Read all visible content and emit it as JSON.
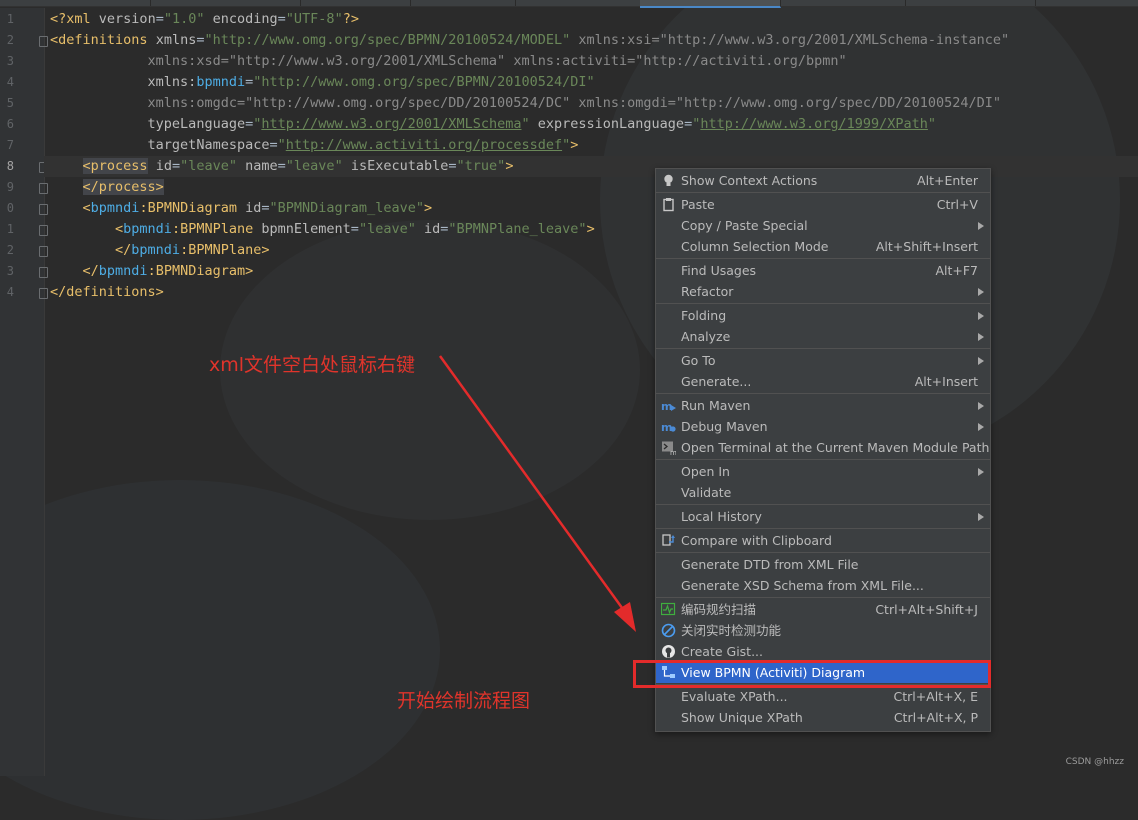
{
  "code": {
    "line1": {
      "num": "1"
    },
    "line2": {
      "num": "2"
    },
    "line3": {
      "num": "3"
    },
    "line4": {
      "num": "4"
    },
    "line5": {
      "num": "5"
    },
    "line6": {
      "num": "6"
    },
    "line7": {
      "num": "7"
    },
    "line8": {
      "num": "8"
    },
    "line9": {
      "num": "9"
    },
    "line10": {
      "num": "0"
    },
    "line11": {
      "num": "1"
    },
    "line12": {
      "num": "2"
    },
    "line13": {
      "num": "3"
    },
    "line14": {
      "num": "4"
    },
    "xml_decl": {
      "open": "<?",
      "tag": "xml",
      "attr1": "version",
      "val1": "\"1.0\"",
      "attr2": "encoding",
      "val2": "\"UTF-8\"",
      "close": "?>"
    },
    "definitions": {
      "open": "<",
      "tag": "definitions",
      "xmlns": "xmlns",
      "xmlns_val": "\"http://www.omg.org/spec/BPMN/20100524/MODEL\"",
      "xsi": "xmlns:xsi",
      "xsi_val": "\"http://www.w3.org/2001/XMLSchema-instance\"",
      "xsd": "xmlns:xsd",
      "xsd_val": "\"http://www.w3.org/2001/XMLSchema\"",
      "activiti": "xmlns:activiti",
      "activiti_val": "\"http://activiti.org/bpmn\"",
      "bpmndi_ns": "xmlns:",
      "bpmndi_name": "bpmndi",
      "bpmndi_val": "\"http://www.omg.org/spec/BPMN/20100524/DI\"",
      "omgdc": "xmlns:omgdc",
      "omgdc_val": "\"http://www.omg.org/spec/DD/20100524/DC\"",
      "omgdi": "xmlns:omgdi",
      "omgdi_val": "\"http://www.omg.org/spec/DD/20100524/DI\"",
      "typelang": "typeLanguage",
      "typelang_val_q1": "\"",
      "typelang_val_url": "http://www.w3.org/2001/XMLSchema",
      "typelang_val_q2": "\"",
      "exprlang": "expressionLanguage",
      "exprlang_val_q1": "\"",
      "exprlang_val_url": "http://www.w3.org/1999/XPath",
      "exprlang_val_q2": "\"",
      "targetns": "targetNamespace",
      "targetns_val_q1": "\"",
      "targetns_val_url": "http://www.activiti.org/processdef",
      "targetns_val_q2": "\"",
      "end": ">",
      "close": "</definitions>"
    },
    "process": {
      "open": "<process",
      "id": "id",
      "id_val": "\"leave\"",
      "name": "name",
      "name_val": "\"leave\"",
      "exec": "isExecutable",
      "exec_val": "\"true\"",
      "end": ">",
      "close": "</process>"
    },
    "diagram": {
      "open": "<",
      "prefix": "bpmndi",
      "colon": ":",
      "tag": "BPMNDiagram",
      "id": "id",
      "id_val": "\"BPMNDiagram_leave\"",
      "end": ">",
      "close_open": "</",
      "close_end": ">"
    },
    "plane": {
      "open": "<",
      "prefix": "bpmndi",
      "colon": ":",
      "tag": "BPMNPlane",
      "elem": "bpmnElement",
      "elem_val": "\"leave\"",
      "id": "id",
      "id_val": "\"BPMNPlane_leave\"",
      "end": ">",
      "close_open": "</",
      "close_end": ">"
    }
  },
  "annotations": {
    "right_click_note": "xml文件空白处鼠标右键",
    "start_drawing_note": "开始绘制流程图"
  },
  "menu": {
    "items": [
      {
        "label": "Show Context Actions",
        "shortcut": "Alt+Enter",
        "icon": "bulb-icon"
      },
      {
        "label": "Paste",
        "shortcut": "Ctrl+V",
        "icon": "clipboard-icon"
      },
      {
        "label": "Copy / Paste Special",
        "submenu": true
      },
      {
        "label": "Column Selection Mode",
        "shortcut": "Alt+Shift+Insert"
      },
      {
        "label": "Find Usages",
        "shortcut": "Alt+F7"
      },
      {
        "label": "Refactor",
        "submenu": true
      },
      {
        "label": "Folding",
        "submenu": true
      },
      {
        "label": "Analyze",
        "submenu": true
      },
      {
        "label": "Go To",
        "submenu": true
      },
      {
        "label": "Generate...",
        "shortcut": "Alt+Insert"
      },
      {
        "label": "Run Maven",
        "submenu": true,
        "icon": "maven-run-icon"
      },
      {
        "label": "Debug Maven",
        "submenu": true,
        "icon": "maven-debug-icon"
      },
      {
        "label": "Open Terminal at the Current Maven Module Path",
        "icon": "terminal-icon"
      },
      {
        "label": "Open In",
        "submenu": true
      },
      {
        "label": "Validate"
      },
      {
        "label": "Local History",
        "submenu": true
      },
      {
        "label": "Compare with Clipboard",
        "icon": "compare-icon"
      },
      {
        "label": "Generate DTD from XML File"
      },
      {
        "label": "Generate XSD Schema from XML File..."
      },
      {
        "label": "编码规约扫描",
        "shortcut": "Ctrl+Alt+Shift+J",
        "icon": "scan-icon"
      },
      {
        "label": "关闭实时检测功能",
        "icon": "disable-icon"
      },
      {
        "label": "Create Gist...",
        "icon": "github-icon"
      },
      {
        "label": "View BPMN (Activiti) Diagram",
        "icon": "bpmn-icon",
        "selected": true
      },
      {
        "label": "Evaluate XPath...",
        "shortcut": "Ctrl+Alt+X, E"
      },
      {
        "label": "Show Unique XPath",
        "shortcut": "Ctrl+Alt+X, P"
      }
    ]
  },
  "watermark": "CSDN @hhzz",
  "colors": {
    "highlight_box": "#e32b2b",
    "annotation_text": "#e0342b",
    "selection": "#2f65ca"
  }
}
